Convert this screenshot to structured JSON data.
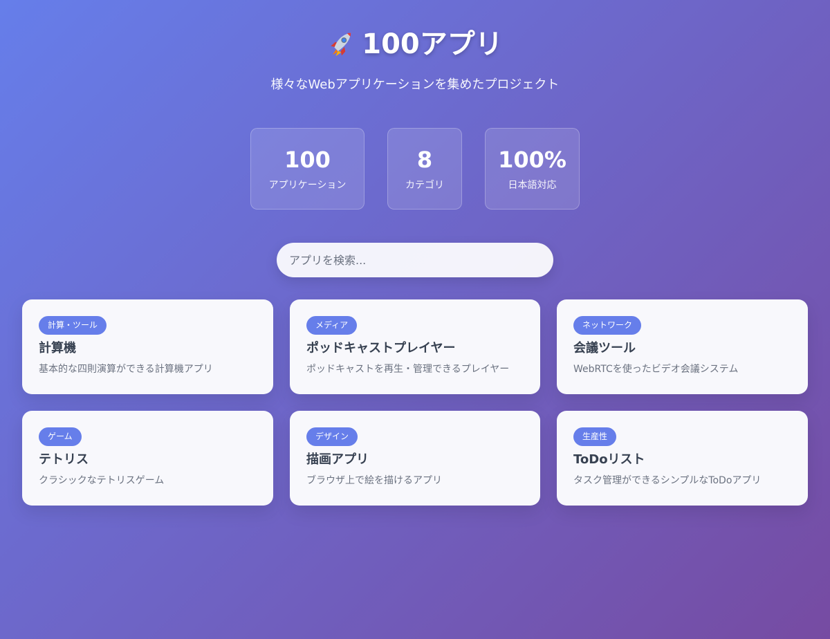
{
  "header": {
    "icon": "rocket-icon",
    "title": "100アプリ",
    "subtitle": "様々なWebアプリケーションを集めたプロジェクト"
  },
  "stats": [
    {
      "value": "100",
      "label": "アプリケーション"
    },
    {
      "value": "8",
      "label": "カテゴリ"
    },
    {
      "value": "100%",
      "label": "日本語対応"
    }
  ],
  "search": {
    "value": "",
    "placeholder": "アプリを検索..."
  },
  "colors": {
    "background_start": "#667eea",
    "background_end": "#764ba2",
    "badge": "#667eea",
    "card_background": "#f8f8fc",
    "card_title": "#374151",
    "card_description": "#6b7280"
  },
  "apps": [
    {
      "category": "計算・ツール",
      "name": "計算機",
      "description": "基本的な四則演算ができる計算機アプリ"
    },
    {
      "category": "メディア",
      "name": "ポッドキャストプレイヤー",
      "description": "ポッドキャストを再生・管理できるプレイヤー"
    },
    {
      "category": "ネットワーク",
      "name": "会議ツール",
      "description": "WebRTCを使ったビデオ会議システム"
    },
    {
      "category": "ゲーム",
      "name": "テトリス",
      "description": "クラシックなテトリスゲーム"
    },
    {
      "category": "デザイン",
      "name": "描画アプリ",
      "description": "ブラウザ上で絵を描けるアプリ"
    },
    {
      "category": "生産性",
      "name": "ToDoリスト",
      "description": "タスク管理ができるシンプルなToDoアプリ"
    }
  ]
}
